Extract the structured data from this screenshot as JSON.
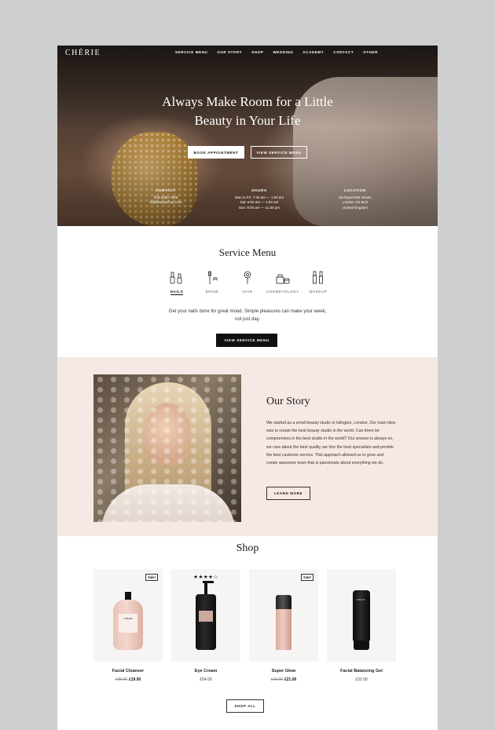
{
  "brand": {
    "logo": "CHÉRIE"
  },
  "nav": {
    "items": [
      "SERVICE MENU",
      "OUR STORY",
      "SHOP",
      "WEDDING",
      "ACADEMY",
      "CONTACT",
      "OTHER"
    ]
  },
  "hero": {
    "headline_line1": "Always Make Room for a Little",
    "headline_line2": "Beauty in Your Life",
    "btn_book": "BOOK APPOINTMENT",
    "btn_view": "VIEW SERVICE MENU",
    "contact": {
      "heading": "CONTACT",
      "phone": "020-3455-7868",
      "email": "hi@beautyshop.com"
    },
    "hours": {
      "heading": "HOURS",
      "line1": "Mon to Fri: 7:30 am — 1:00 am",
      "line2": "Sat: 9:00 am — 1:00 am",
      "line3": "Sun: 9:00 am — 11:30 pm"
    },
    "location": {
      "heading": "LOCATION",
      "line1": "45 Royal Mint Street,",
      "line2": "London, E1 8LG",
      "line3": "United Kingdom"
    }
  },
  "service_menu": {
    "title": "Service Menu",
    "tabs": [
      {
        "label": "NAILS",
        "icon": "nail-polish-icon",
        "active": true
      },
      {
        "label": "BROW",
        "icon": "brow-brush-icon",
        "active": false
      },
      {
        "label": "HAIR",
        "icon": "hair-pin-icon",
        "active": false
      },
      {
        "label": "COSMETOLOGY",
        "icon": "cosmetics-icon",
        "active": false
      },
      {
        "label": "MAKEUP",
        "icon": "makeup-brush-icon",
        "active": false
      }
    ],
    "desc_line1": "Get your nails done for great mood. Simple pleasures can make your week,",
    "desc_line2": "not just day.",
    "button": "VIEW SERVICE MENU"
  },
  "story": {
    "title": "Our Story",
    "text": "We started as a small beauty studio in Islington, London. Our main idea was to create the best beauty studio in the world. Can there be compromises in the best studio in the world? Our answer is always no, we care about the best quality, we hire the best specialists and provide the best customer service. This approach allowed us to grow and create awesome team that is passionate about everything we do.",
    "button": "LEARN MORE"
  },
  "shop": {
    "title": "Shop",
    "products": [
      {
        "name": "Facial Cleanser",
        "old_price": "£25.00",
        "price": "£19.00",
        "badge": "Sale!"
      },
      {
        "name": "Eye Cream",
        "old_price": "",
        "price": "£54.00",
        "rating": "★★★★☆"
      },
      {
        "name": "Super Glow",
        "old_price": "£29.00",
        "price": "£21.00",
        "badge": "Sale!"
      },
      {
        "name": "Facial Balancing Gel",
        "old_price": "",
        "price": "£32.00"
      }
    ],
    "button": "SHOP ALL",
    "bottle_logo": "CHÉRIE"
  },
  "colors": {
    "story_bg": "#f6e8e4",
    "dark": "#111111",
    "outer_bg": "#cfcfcf"
  }
}
